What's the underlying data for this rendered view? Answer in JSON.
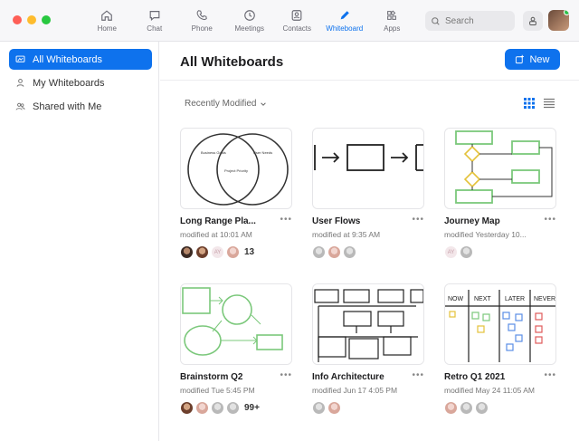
{
  "nav": {
    "tabs": [
      {
        "label": "Home",
        "icon": "home-icon"
      },
      {
        "label": "Chat",
        "icon": "chat-icon"
      },
      {
        "label": "Phone",
        "icon": "phone-icon"
      },
      {
        "label": "Meetings",
        "icon": "clock-icon"
      },
      {
        "label": "Contacts",
        "icon": "contacts-icon"
      },
      {
        "label": "Whiteboard",
        "icon": "pen-icon",
        "active": true
      },
      {
        "label": "Apps",
        "icon": "apps-icon"
      }
    ],
    "search_placeholder": "Search"
  },
  "colors": {
    "accent": "#0e72ed",
    "online": "#2ec04a"
  },
  "sidebar": {
    "items": [
      {
        "label": "All Whiteboards",
        "icon": "whiteboard-icon",
        "active": true
      },
      {
        "label": "My Whiteboards",
        "icon": "person-icon"
      },
      {
        "label": "Shared with Me",
        "icon": "people-icon"
      }
    ]
  },
  "main": {
    "title": "All Whiteboards",
    "new_label": "New",
    "sort_label": "Recently Modified",
    "cards": [
      {
        "title": "Long Range Pla...",
        "modified": "modified at 10:01 AM",
        "count": "13"
      },
      {
        "title": "User Flows",
        "modified": "modified at 9:35 AM",
        "count": ""
      },
      {
        "title": "Journey Map",
        "modified": "modified Yesterday 10...",
        "count": ""
      },
      {
        "title": "Brainstorm Q2",
        "modified": "modified Tue 5:45 PM",
        "count": "99+"
      },
      {
        "title": "Info Architecture",
        "modified": "modified Jun 17 4:05 PM",
        "count": ""
      },
      {
        "title": "Retro Q1 2021",
        "modified": "modified May 24 11:05 AM",
        "count": ""
      }
    ],
    "thumb_text": {
      "venn_left": "Business Goals",
      "venn_right": "User Needs",
      "venn_center": "Project Priority",
      "retro_cols": [
        "NOW",
        "NEXT",
        "LATER",
        "NEVER"
      ]
    },
    "initials": "AY"
  }
}
